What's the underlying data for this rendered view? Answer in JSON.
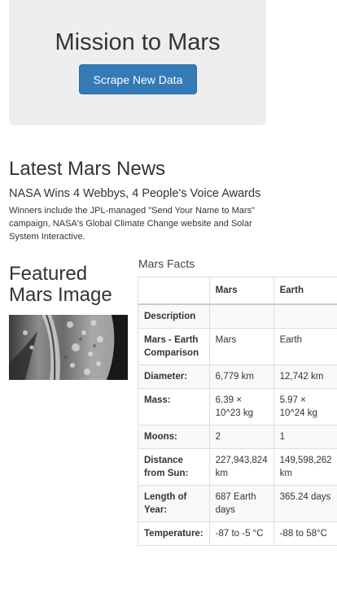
{
  "jumbotron": {
    "title": "Mission to Mars",
    "button_label": "Scrape New Data"
  },
  "news": {
    "heading": "Latest Mars News",
    "title": "NASA Wins 4 Webbys, 4 People's Voice Awards",
    "teaser": "Winners include the JPL-managed \"Send Your Name to Mars\" campaign, NASA's Global Climate Change website and Solar System Interactive."
  },
  "featured": {
    "heading": "Featured Mars Image"
  },
  "facts": {
    "caption": "Mars Facts",
    "columns": [
      "",
      "Mars",
      "Earth"
    ],
    "rows": [
      [
        "Description",
        "",
        ""
      ],
      [
        "Mars - Earth Comparison",
        "Mars",
        "Earth"
      ],
      [
        "Diameter:",
        "6,779 km",
        "12,742 km"
      ],
      [
        "Mass:",
        "6.39 × 10^23 kg",
        "5.97 × 10^24 kg"
      ],
      [
        "Moons:",
        "2",
        "1"
      ],
      [
        "Distance from Sun:",
        "227,943,824 km",
        "149,598,262 km"
      ],
      [
        "Length of Year:",
        "687 Earth days",
        "365.24 days"
      ],
      [
        "Temperature:",
        "-87 to -5 °C",
        "-88 to 58°C"
      ]
    ]
  },
  "colors": {
    "button_bg": "#337ab7",
    "jumbotron_bg": "#eeeeee"
  }
}
